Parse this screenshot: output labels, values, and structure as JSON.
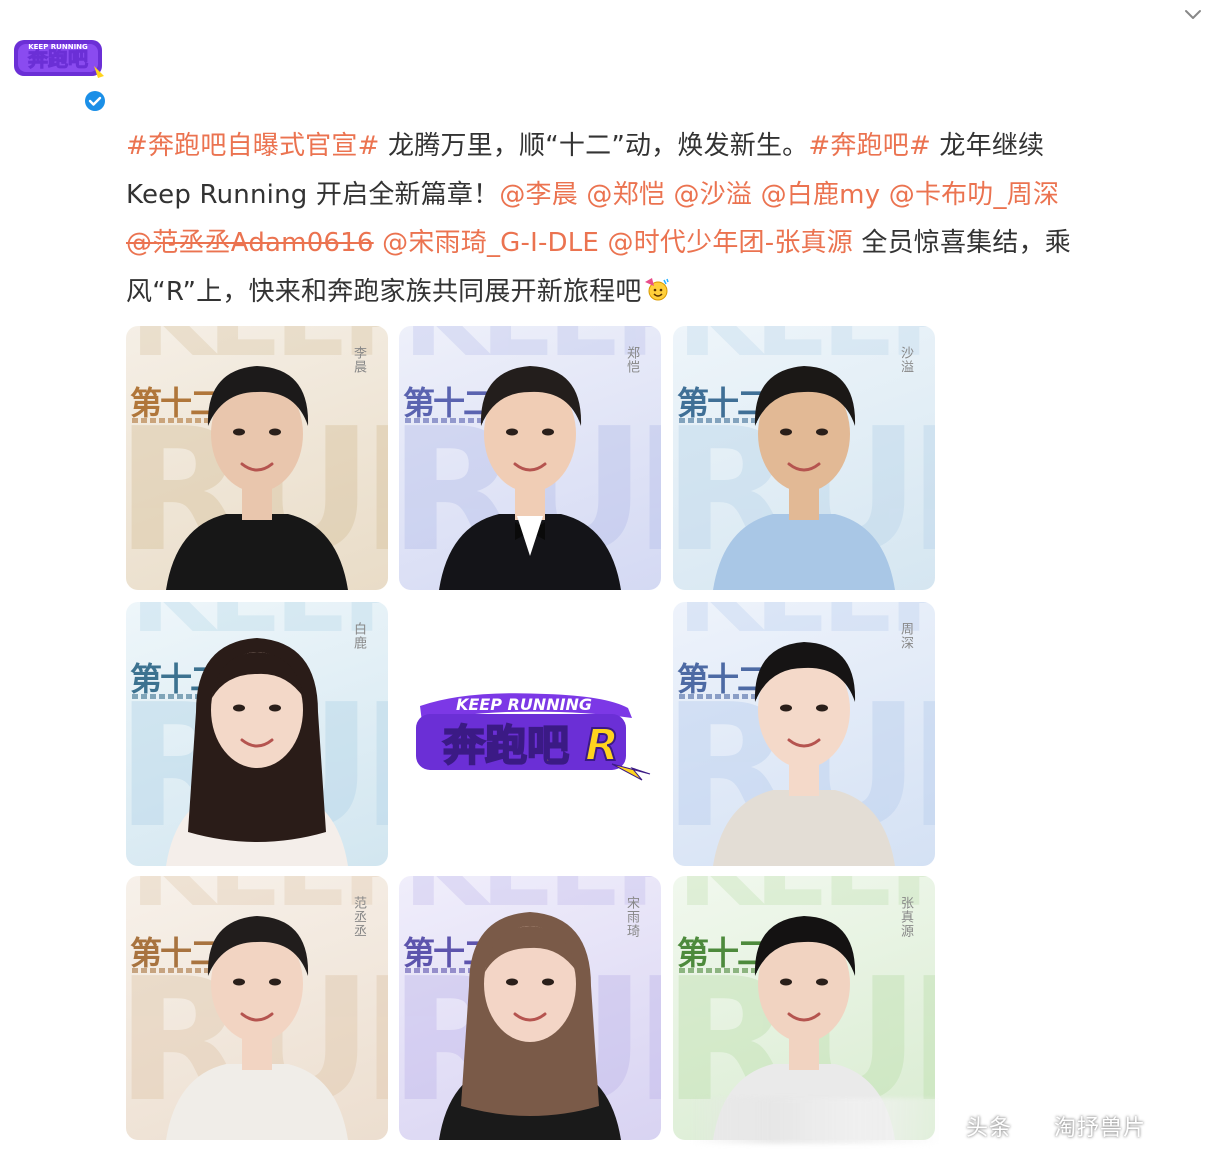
{
  "account": {
    "avatar_logo_text": "奔跑吧",
    "avatar_logo_top_text": "KEEP RUNNING",
    "verified_icon": "verified-badge-icon",
    "menu_icon": "chevron-down-icon"
  },
  "post": {
    "lines": [
      [
        {
          "type": "tag",
          "text": "#奔跑吧自曝式官宣#"
        },
        {
          "type": "text",
          "text": " 龙腾万里，顺“十二”动，焕发新生。"
        },
        {
          "type": "tag",
          "text": "#奔跑吧#"
        },
        {
          "type": "text",
          "text": " 龙年继续"
        }
      ],
      [
        {
          "type": "text",
          "text": "Keep Running 开启全新篇章！"
        },
        {
          "type": "mention",
          "text": "@李晨"
        },
        {
          "type": "text",
          "text": " "
        },
        {
          "type": "mention",
          "text": "@郑恺"
        },
        {
          "type": "text",
          "text": " "
        },
        {
          "type": "mention",
          "text": "@沙溢"
        },
        {
          "type": "text",
          "text": " "
        },
        {
          "type": "mention",
          "text": "@白鹿my"
        },
        {
          "type": "text",
          "text": " "
        },
        {
          "type": "mention",
          "text": "@卡布叻_周深"
        }
      ],
      [
        {
          "type": "mention-strike",
          "text": "@范丞丞Adam0616"
        },
        {
          "type": "text",
          "text": " "
        },
        {
          "type": "mention",
          "text": "@宋雨琦_G-I-DLE"
        },
        {
          "type": "text",
          "text": " "
        },
        {
          "type": "mention",
          "text": "@时代少年团-张真源"
        },
        {
          "type": "text",
          "text": " 全员惊喜集结，乘"
        }
      ],
      [
        {
          "type": "text",
          "text": "风“R”上，快来和奔跑家族共同展开新旅程吧"
        }
      ]
    ],
    "emoji_icon": "party-emoji-icon"
  },
  "tiles": [
    {
      "name": "李晨",
      "season": "第十二季",
      "big_word": "RUNN",
      "top_word": "KEEP",
      "bg_from": "#f5efe6",
      "bg_to": "#e9dcc7",
      "word_color": "#d8c3a0",
      "season_color": "#b0763a",
      "skin": "#e9c6ad",
      "hair": "#1c1a1a",
      "cloth": "#171717"
    },
    {
      "name": "郑恺",
      "season": "第十二季",
      "big_word": "RUNN",
      "top_word": "KEEP",
      "bg_from": "#eef0fa",
      "bg_to": "#d4d9f3",
      "word_color": "#b9c1ea",
      "season_color": "#5a63b0",
      "skin": "#f0cdb5",
      "hair": "#231e1c",
      "cloth": "#141418"
    },
    {
      "name": "沙溢",
      "season": "第十二季",
      "big_word": "RUNN",
      "top_word": "KEEP",
      "bg_from": "#eef5fa",
      "bg_to": "#d5e6f1",
      "word_color": "#bcd6ea",
      "season_color": "#3f6f96",
      "skin": "#e2b995",
      "hair": "#1b1816",
      "cloth": "#a9c7e6"
    },
    {
      "name": "白鹿",
      "season": "第十二季",
      "big_word": "RUNN",
      "top_word": "KEEP",
      "bg_from": "#eef6fa",
      "bg_to": "#d2e6f0",
      "word_color": "#b6d6e8",
      "season_color": "#3c7290",
      "skin": "#f3d8c8",
      "hair": "#2a1c18",
      "cloth": "#f4eeea"
    },
    {
      "name": "周深",
      "season": "第十二季",
      "big_word": "RUNN",
      "top_word": "KEEP",
      "bg_from": "#eef3fb",
      "bg_to": "#d4e1f4",
      "word_color": "#bacfee",
      "season_color": "#4d6aa4",
      "skin": "#f4d9c9",
      "hair": "#161414",
      "cloth": "#e3ddd5"
    },
    {
      "name": "范丞丞",
      "season": "第十二季",
      "big_word": "RUNN",
      "top_word": "KEEP",
      "bg_from": "#f7f1ea",
      "bg_to": "#ecdecf",
      "word_color": "#dfc8ad",
      "season_color": "#a8733f",
      "skin": "#f2d4c2",
      "hair": "#211d1c",
      "cloth": "#f0ede8"
    },
    {
      "name": "宋雨琦",
      "season": "第十二季",
      "big_word": "RUNN",
      "top_word": "KEEP",
      "bg_from": "#f0eefb",
      "bg_to": "#d8d3f2",
      "word_color": "#c1b9ea",
      "season_color": "#5d54ad",
      "skin": "#f3d5c6",
      "hair": "#7a5a48",
      "cloth": "#1a1a1a"
    },
    {
      "name": "张真源",
      "season": "第十二季",
      "big_word": "RUNN",
      "top_word": "KEEP",
      "bg_from": "#f1f8ee",
      "bg_to": "#d9ecd1",
      "word_color": "#bfe0b0",
      "season_color": "#4d8a3c",
      "skin": "#f1d3c1",
      "hair": "#141212",
      "cloth": "#eaeaea"
    }
  ],
  "center_logo": {
    "top_text": "KEEP RUNNING",
    "main_text": "奔跑吧",
    "letter": "R"
  },
  "watermark": {
    "text_left": "头条",
    "text_right": "淘抒兽片",
    "icon": "toutiao-logo-icon"
  },
  "colors": {
    "link": "#eb7350",
    "text": "#333333",
    "verified": "#1b8fe7",
    "logo_yellow": "#ffd41e",
    "logo_purple": "#6b2fd6"
  }
}
